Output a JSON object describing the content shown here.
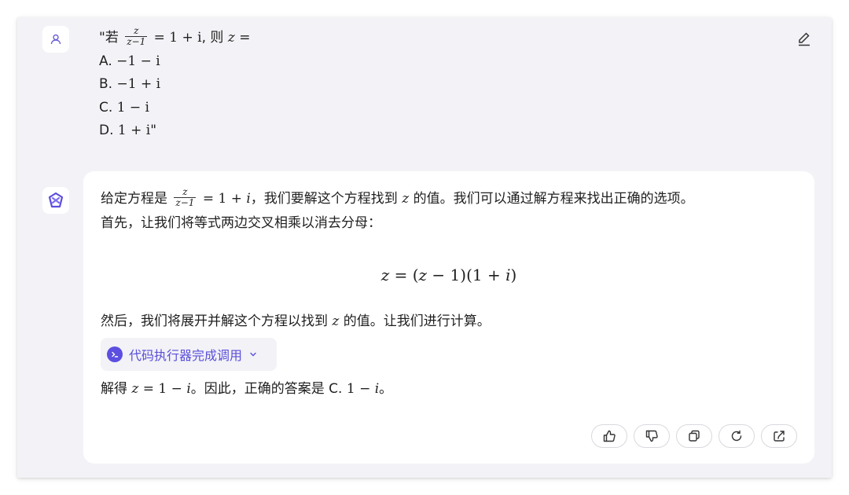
{
  "user": {
    "icon": "user-icon",
    "prefix": "\"若",
    "eq_num": "z",
    "eq_den": "z−1",
    "eq_rhs": "= 1 + i",
    "eq_tail": ", 则",
    "eq_var": "z",
    "eq_end": "=",
    "options": [
      {
        "label": "A.",
        "value": "−1 − i",
        "suffix": ""
      },
      {
        "label": "B.",
        "value": "−1 + i",
        "suffix": ""
      },
      {
        "label": "C.",
        "value": "1 − i",
        "suffix": ""
      },
      {
        "label": "D.",
        "value": "1 + i",
        "suffix": "\""
      }
    ]
  },
  "assistant": {
    "line1_pre": "给定方程是",
    "frac_num": "z",
    "frac_den": "z−1",
    "line1_rhs_eq": "= 1 +",
    "line1_rhs_i": "i",
    "line1_mid": "，我们要解这个方程找到",
    "line1_var": "z",
    "line1_post": "的值。我们可以通过解方程来找出正确的选项。",
    "line2": "首先，让我们将等式两边交叉相乘以消去分母：",
    "display_eq": {
      "z": "z",
      "eq": "= (",
      "z2": "z",
      "mid": "− 1)(1 +",
      "i": "i",
      "end": ")"
    },
    "line3_pre": "然后，我们将展开并解这个方程以找到",
    "line3_var": "z",
    "line3_post": "的值。让我们进行计算。",
    "tool_label": "代码执行器完成调用",
    "line4_pre": "解得",
    "line4_z": "z",
    "line4_eq": "= 1 −",
    "line4_i": "i",
    "line4_mid": "。因此，正确的答案是 C.",
    "line4_val": "1 −",
    "line4_i2": "i",
    "line4_end": "。"
  },
  "actions": [
    "thumbs-up-icon",
    "thumbs-down-icon",
    "copy-icon",
    "regenerate-icon",
    "share-icon"
  ],
  "colors": {
    "accent": "#5b4ee0",
    "card_bg": "#f3f3f7"
  }
}
